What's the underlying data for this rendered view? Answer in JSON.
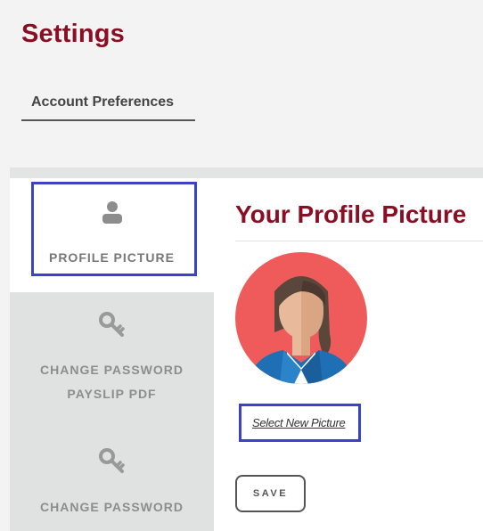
{
  "page": {
    "title": "Settings"
  },
  "tabs": {
    "account_preferences": "Account Preferences"
  },
  "sidebar": {
    "items": [
      {
        "label": "PROFILE PICTURE",
        "icon": "user-icon",
        "active": true
      },
      {
        "label_line1": "CHANGE PASSWORD",
        "label_line2": "PAYSLIP PDF",
        "icon": "key-icon",
        "active": false
      },
      {
        "label": "CHANGE PASSWORD",
        "icon": "key-icon",
        "active": false
      }
    ]
  },
  "main": {
    "title": "Your Profile Picture",
    "select_picture_link": "Select New Picture",
    "save_label": "SAVE"
  },
  "colors": {
    "brand": "#8a0f24",
    "highlight": "#3a43c4",
    "avatar_background": "#ef5b5b"
  }
}
